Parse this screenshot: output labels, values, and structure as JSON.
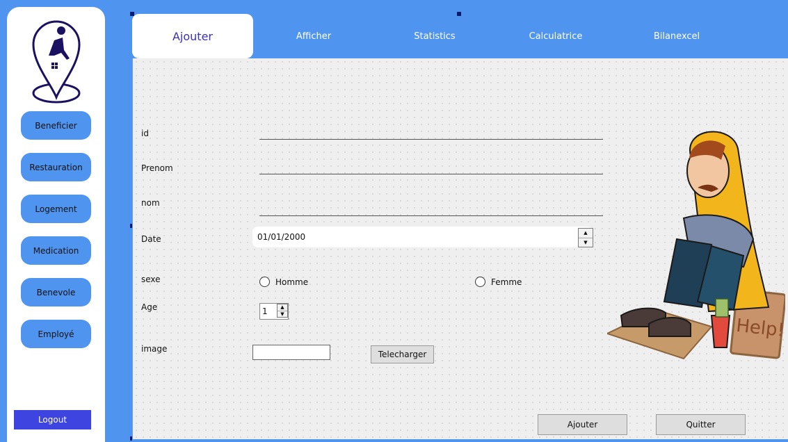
{
  "sidebar": {
    "items": [
      {
        "label": "Beneficier"
      },
      {
        "label": "Restauration"
      },
      {
        "label": "Logement"
      },
      {
        "label": "Medication"
      },
      {
        "label": "Benevole"
      },
      {
        "label": "Employé"
      }
    ],
    "logout_label": "Logout"
  },
  "tabs": [
    {
      "label": "Ajouter",
      "active": true
    },
    {
      "label": "Afficher"
    },
    {
      "label": "Statistics"
    },
    {
      "label": "Calculatrice"
    },
    {
      "label": "Bilanexcel"
    }
  ],
  "form": {
    "id_label": "id",
    "prenom_label": "Prenom",
    "nom_label": "nom",
    "date_label": "Date",
    "date_value": "01/01/2000",
    "sexe_label": "sexe",
    "sexe_options": [
      "Homme",
      "Femme"
    ],
    "age_label": "Age",
    "age_value": "1",
    "image_label": "image",
    "upload_label": "Telecharger"
  },
  "actions": {
    "add_label": "Ajouter",
    "quit_label": "Quitter"
  },
  "illustration": {
    "sign_text": "Help!"
  },
  "colors": {
    "background": "#4f94ee",
    "logout": "#3d44e0",
    "active_tab_text": "#3a32b0"
  }
}
